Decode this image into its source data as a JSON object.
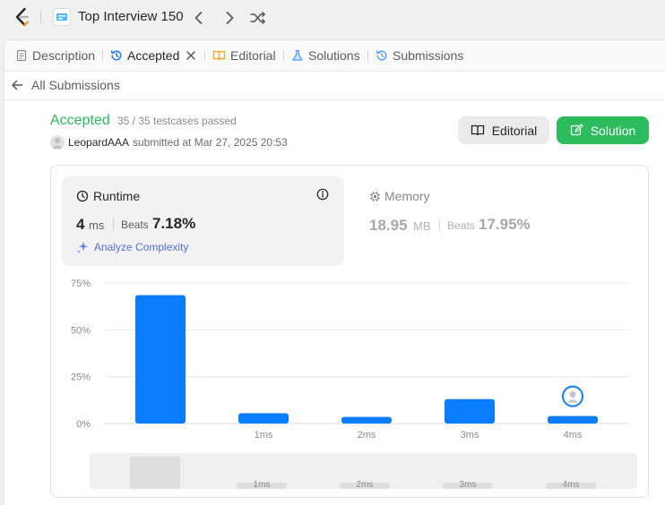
{
  "header": {
    "list_title": "Top Interview 150"
  },
  "tabs": [
    {
      "label": "Description"
    },
    {
      "label": "Accepted"
    },
    {
      "label": "Editorial"
    },
    {
      "label": "Solutions"
    },
    {
      "label": "Submissions"
    }
  ],
  "back": {
    "label": "All Submissions"
  },
  "submission": {
    "status": "Accepted",
    "testcases": "35 / 35 testcases passed",
    "user": "LeopardAAA",
    "submitted": "submitted at Mar 27, 2025 20:53"
  },
  "buttons": {
    "editorial": "Editorial",
    "solution": "Solution"
  },
  "runtime": {
    "title": "Runtime",
    "value": "4",
    "unit": "ms",
    "beats_label": "Beats",
    "beats_value": "7.18%",
    "analyze_label": "Analyze Complexity"
  },
  "memory": {
    "title": "Memory",
    "value": "18.95",
    "unit": "MB",
    "beats_label": "Beats",
    "beats_value": "17.95%"
  },
  "colors": {
    "accepted": "#2db55d",
    "solution_button": "#2cbb5d",
    "bar": "#0a7cff",
    "analyze": "#5470d8"
  },
  "chart_data": {
    "type": "bar",
    "categories": [
      "",
      "1ms",
      "2ms",
      "3ms",
      "4ms"
    ],
    "values": [
      68.5,
      5.5,
      3.5,
      13,
      4
    ],
    "yticks": [
      "0%",
      "25%",
      "50%",
      "75%"
    ],
    "ylim": [
      0,
      75
    ],
    "highlight_category": "4ms",
    "mini_categories": [
      "1ms",
      "2ms",
      "3ms",
      "4ms"
    ],
    "grid": true
  }
}
